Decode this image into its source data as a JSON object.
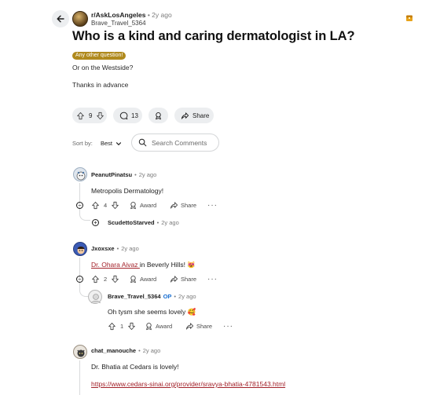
{
  "post": {
    "subreddit": "r/AskLosAngeles",
    "time": "2y ago",
    "author": "Brave_Travel_5364",
    "title": "Who is a kind and caring dermatologist in LA?",
    "flair": "Any other question!",
    "body_line1": "Or on the Westside?",
    "body_line2": "Thanks in advance",
    "vote_count": "9",
    "comment_count": "13",
    "share_label": "Share"
  },
  "sort": {
    "label": "Sort by:",
    "value": "Best",
    "search_placeholder": "Search Comments"
  },
  "comments": [
    {
      "author": "PeanutPinatsu",
      "time": "2y ago",
      "text": "Metropolis Dermatology!",
      "votes": "4",
      "award": "Award",
      "share": "Share",
      "reply": {
        "author": "ScudettoStarved",
        "time": "2y ago"
      }
    },
    {
      "author": "Jxoxsxe",
      "time": "2y ago",
      "link_text": "Dr. Ohara Aivaz ",
      "text_after": "in Beverly Hills! 😻",
      "votes": "2",
      "award": "Award",
      "share": "Share",
      "reply": {
        "author": "Brave_Travel_5364",
        "op": "OP",
        "time": "2y ago",
        "text": "Oh tysm she seems lovely 🥰",
        "votes": "1",
        "award": "Award",
        "share": "Share"
      }
    },
    {
      "author": "chat_manouche",
      "time": "2y ago",
      "text": "Dr. Bhatia at Cedars is lovely!",
      "link": "https://www.cedars-sinai.org/provider/sravya-bhatia-4781543.html"
    }
  ],
  "icons": {
    "back": "arrow-left-icon",
    "upvote": "arrow-up-icon",
    "downvote": "arrow-down-icon",
    "comment": "speech-bubble-icon",
    "award": "award-ribbon-icon",
    "share": "share-arrow-icon",
    "search": "search-icon",
    "more": "ellipsis-icon",
    "collapse": "minus-circle-icon",
    "expand": "plus-circle-icon"
  },
  "colors": {
    "flair": "#b08a1d",
    "op": "#1a6fd1",
    "link": "#a3222a",
    "pill": "#eceef0"
  }
}
